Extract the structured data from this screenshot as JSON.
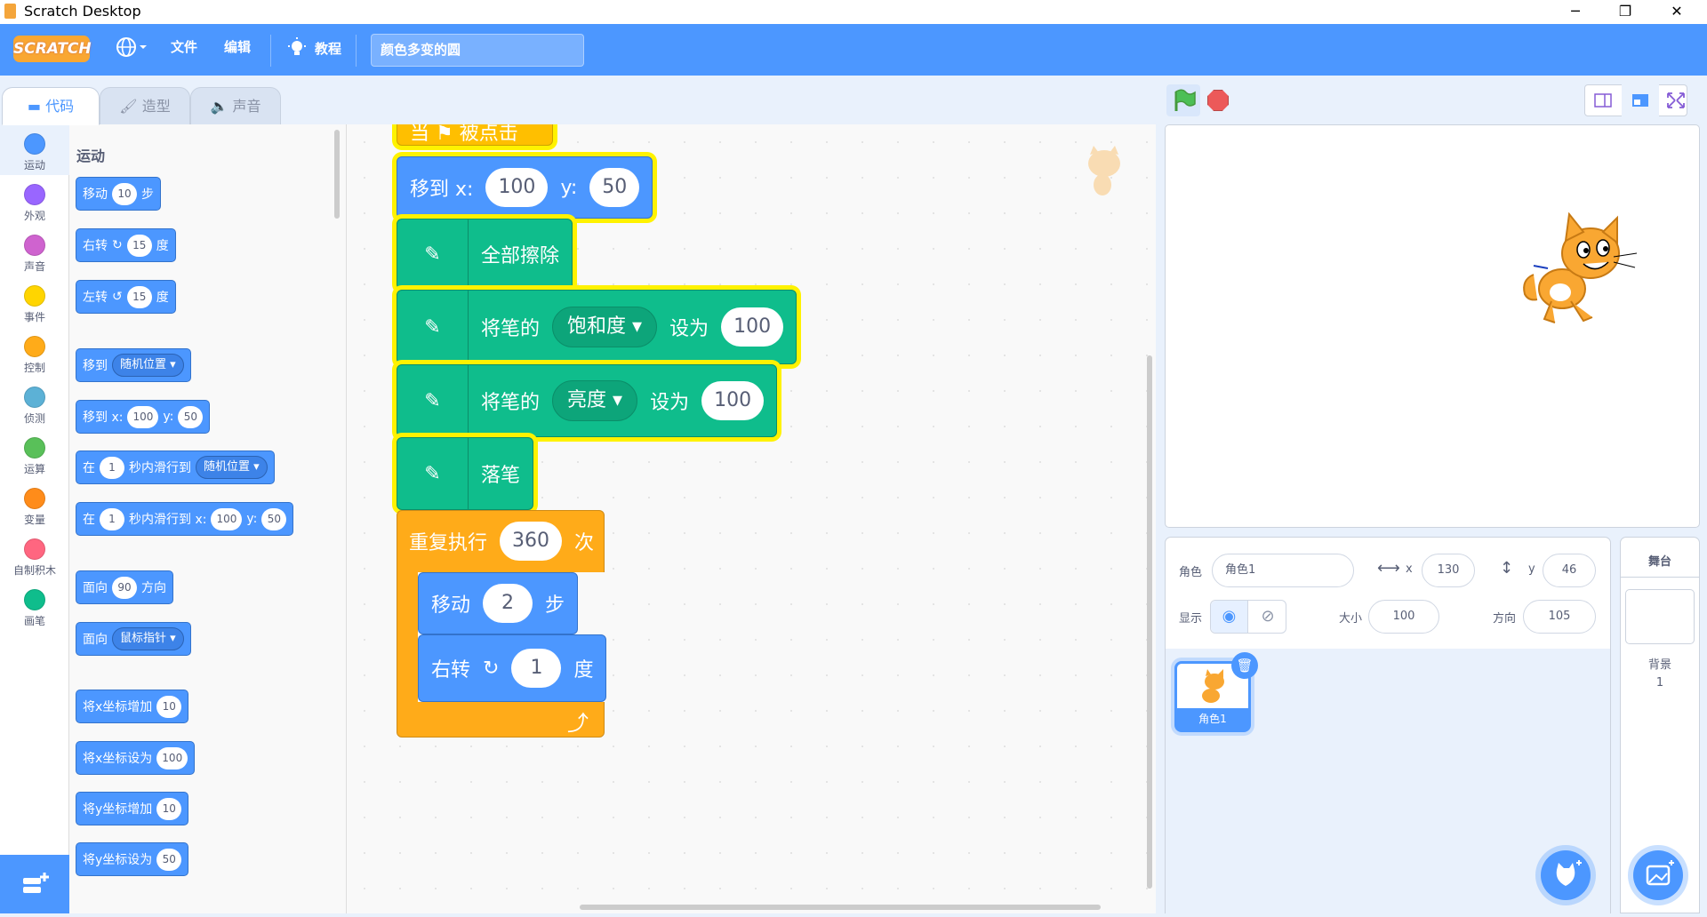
{
  "window": {
    "title": "Scratch Desktop",
    "minimize": "─",
    "maximize": "❐",
    "close": "✕"
  },
  "menubar": {
    "logo": "SCRATCH",
    "file": "文件",
    "edit": "编辑",
    "tutorials": "教程",
    "project_title": "颜色多变的圆"
  },
  "tabs": {
    "code": "代码",
    "costumes": "造型",
    "sounds": "声音"
  },
  "categories": [
    {
      "label": "运动",
      "color": "#4c97ff"
    },
    {
      "label": "外观",
      "color": "#9966ff"
    },
    {
      "label": "声音",
      "color": "#cf63cf"
    },
    {
      "label": "事件",
      "color": "#ffd500"
    },
    {
      "label": "控制",
      "color": "#ffab19"
    },
    {
      "label": "侦测",
      "color": "#5cb1d6"
    },
    {
      "label": "运算",
      "color": "#59c059"
    },
    {
      "label": "变量",
      "color": "#ff8c1a"
    },
    {
      "label": "自制积木",
      "color": "#ff6680"
    },
    {
      "label": "画笔",
      "color": "#0fbd8c"
    }
  ],
  "palette": {
    "heading": "运动",
    "move": {
      "a": "移动",
      "v": "10",
      "b": "步"
    },
    "turn_right": {
      "a": "右转",
      "v": "15",
      "b": "度"
    },
    "turn_left": {
      "a": "左转",
      "v": "15",
      "b": "度"
    },
    "goto": {
      "a": "移到",
      "dd": "随机位置"
    },
    "goto_xy": {
      "a": "移到 x:",
      "x": "100",
      "yl": "y:",
      "y": "50"
    },
    "glide": {
      "a": "在",
      "v": "1",
      "b": "秒内滑行到",
      "dd": "随机位置"
    },
    "glide_xy": {
      "a": "在",
      "v": "1",
      "b": "秒内滑行到 x:",
      "x": "100",
      "yl": "y:",
      "y": "50"
    },
    "point": {
      "a": "面向",
      "v": "90",
      "b": "方向"
    },
    "point_towards": {
      "a": "面向",
      "dd": "鼠标指针"
    },
    "change_x": {
      "a": "将x坐标增加",
      "v": "10"
    },
    "set_x": {
      "a": "将x坐标设为",
      "v": "100"
    },
    "change_y": {
      "a": "将y坐标增加",
      "v": "10"
    },
    "set_y": {
      "a": "将y坐标设为",
      "v": "50"
    }
  },
  "script": {
    "hat": "当 ⚑ 被点击",
    "goto": {
      "a": "移到 x:",
      "x": "100",
      "yl": "y:",
      "y": "50"
    },
    "clear": "全部擦除",
    "set_sat": {
      "a": "将笔的",
      "dd": "饱和度",
      "b": "设为",
      "v": "100"
    },
    "set_bri": {
      "a": "将笔的",
      "dd": "亮度",
      "b": "设为",
      "v": "100"
    },
    "pen_down": "落笔",
    "repeat": {
      "a": "重复执行",
      "v": "360",
      "b": "次"
    },
    "move": {
      "a": "移动",
      "v": "2",
      "b": "步"
    },
    "turn": {
      "a": "右转",
      "v": "1",
      "b": "度"
    }
  },
  "zoom": {
    "in": "+",
    "out": "−",
    "reset": "="
  },
  "sprite_info": {
    "sprite_label": "角色",
    "sprite_name": "角色1",
    "x_label": "x",
    "x": "130",
    "y_label": "y",
    "y": "46",
    "show_label": "显示",
    "size_label": "大小",
    "size": "100",
    "dir_label": "方向",
    "dir": "105"
  },
  "sprite_thumb": {
    "name": "角色1"
  },
  "stage_panel": {
    "title": "舞台",
    "backdrop_label": "背景",
    "backdrop_count": "1"
  }
}
